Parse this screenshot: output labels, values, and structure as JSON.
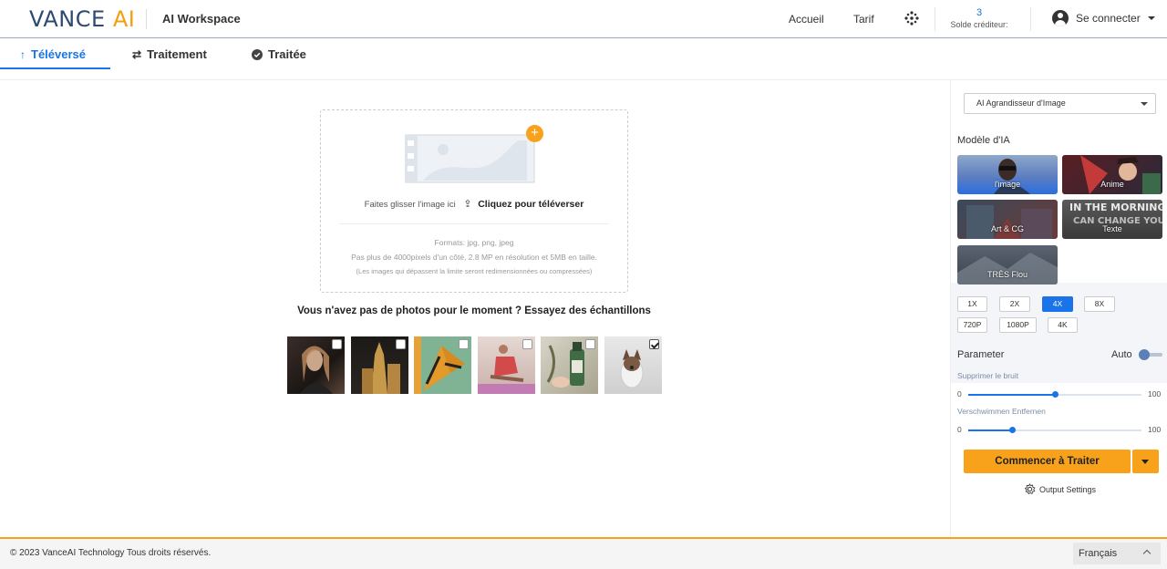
{
  "header": {
    "logo_main": "VANCE",
    "logo_ai": "AI",
    "workspace": "AI Workspace",
    "nav": [
      "Accueil",
      "Tarif"
    ],
    "credit_count": "3",
    "credit_label": "Solde créditeur:",
    "login_label": "Se connecter"
  },
  "tabs": [
    "Téléversé",
    "Traitement",
    "Traitée"
  ],
  "upload": {
    "drag_text": "Faites glisser l'image ici",
    "click_text": "Cliquez pour téléverser",
    "formats": "Formats: jpg, png, jpeg",
    "limit": "Pas plus de 4000pixels d'un côté, 2.8 MP en résolution et 5MB en taille.",
    "note": "(Les images qui dépassent la limite seront redimensionnées ou compressées)"
  },
  "samples_title": "Vous n'avez pas de photos pour le moment ? Essayez des échantillons",
  "right_panel": {
    "tool_select": "AI Agrandisseur d'Image",
    "model_title": "Modèle d'IA",
    "models": [
      "l'image",
      "Anime",
      "Art & CG",
      "Texte",
      "TRÈS Flou"
    ],
    "scales": [
      "1X",
      "2X",
      "4X",
      "8X",
      "720P",
      "1080P",
      "4K"
    ],
    "active_scale": "4X",
    "parameter_label": "Parameter",
    "auto_label": "Auto",
    "slider1_label": "Supprimer le bruit",
    "slider1_min": "0",
    "slider1_max": "100",
    "slider1_value": 50,
    "slider2_label": "Verschwimmen Entfernen",
    "slider2_min": "0",
    "slider2_max": "100",
    "slider2_value": 25,
    "start_button": "Commencer à Traiter",
    "output_settings": "Output Settings"
  },
  "footer": {
    "copyright": "© 2023 VanceAI Technology Tous droits réservés.",
    "language": "Français"
  }
}
